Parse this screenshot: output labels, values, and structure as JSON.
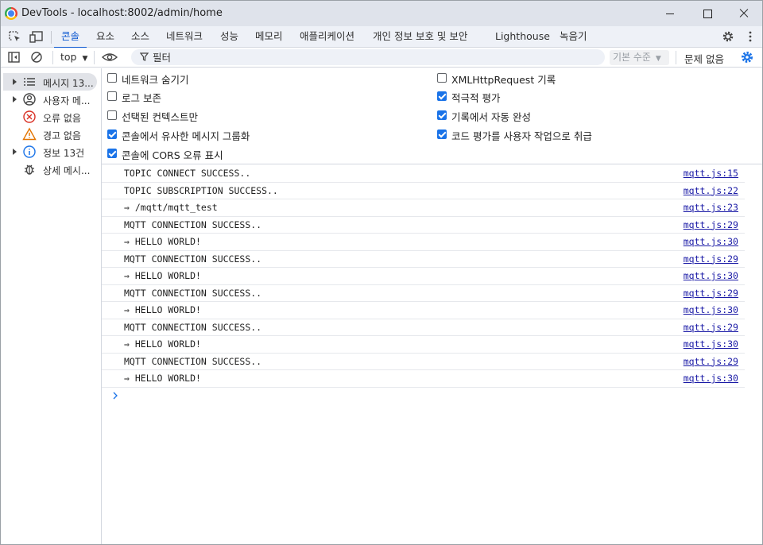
{
  "window": {
    "title": "DevTools - localhost:8002/admin/home"
  },
  "tabs": [
    {
      "label": "콘솔"
    },
    {
      "label": "요소"
    },
    {
      "label": "소스"
    },
    {
      "label": "네트워크"
    },
    {
      "label": "성능"
    },
    {
      "label": "메모리"
    },
    {
      "label": "애플리케이션"
    },
    {
      "label": "개인 정보 보호 및 보안"
    },
    {
      "label": "Lighthouse"
    },
    {
      "label": "녹음기"
    }
  ],
  "toolbar": {
    "context": "top",
    "filter_placeholder": "필터",
    "levels": "기본 수준",
    "issues": "문제 없음"
  },
  "sidebar": {
    "items": [
      {
        "label": "메시지 13...",
        "icon": "list-icon"
      },
      {
        "label": "사용자 메...",
        "icon": "user-circle-icon"
      },
      {
        "label": "오류 없음",
        "icon": "error-icon"
      },
      {
        "label": "경고 없음",
        "icon": "warning-icon"
      },
      {
        "label": "정보 13건",
        "icon": "info-icon"
      },
      {
        "label": "상세 메시...",
        "icon": "bug-icon"
      }
    ]
  },
  "settings": {
    "left": [
      {
        "label": "네트워크 숨기기",
        "checked": false
      },
      {
        "label": "로그 보존",
        "checked": false
      },
      {
        "label": "선택된 컨텍스트만",
        "checked": false
      },
      {
        "label": "콘솔에서 유사한 메시지 그룹화",
        "checked": true
      },
      {
        "label": "콘솔에 CORS 오류 표시",
        "checked": true
      }
    ],
    "right": [
      {
        "label": "XMLHttpRequest 기록",
        "checked": false
      },
      {
        "label": "적극적 평가",
        "checked": true
      },
      {
        "label": "기록에서 자동 완성",
        "checked": true
      },
      {
        "label": "코드 평가를 사용자 작업으로 취급",
        "checked": true
      }
    ]
  },
  "messages": [
    {
      "text": "TOPIC CONNECT SUCCESS..",
      "source": "mqtt.js:15"
    },
    {
      "text": "TOPIC SUBSCRIPTION SUCCESS..",
      "source": "mqtt.js:22"
    },
    {
      "text": "⇒ /mqtt/mqtt_test",
      "source": "mqtt.js:23"
    },
    {
      "text": "MQTT CONNECTION SUCCESS..",
      "source": "mqtt.js:29"
    },
    {
      "text": "⇒ HELLO WORLD!",
      "source": "mqtt.js:30"
    },
    {
      "text": "MQTT CONNECTION SUCCESS..",
      "source": "mqtt.js:29"
    },
    {
      "text": "⇒ HELLO WORLD!",
      "source": "mqtt.js:30"
    },
    {
      "text": "MQTT CONNECTION SUCCESS..",
      "source": "mqtt.js:29"
    },
    {
      "text": "⇒ HELLO WORLD!",
      "source": "mqtt.js:30"
    },
    {
      "text": "MQTT CONNECTION SUCCESS..",
      "source": "mqtt.js:29"
    },
    {
      "text": "⇒ HELLO WORLD!",
      "source": "mqtt.js:30"
    },
    {
      "text": "MQTT CONNECTION SUCCESS..",
      "source": "mqtt.js:29"
    },
    {
      "text": "⇒ HELLO WORLD!",
      "source": "mqtt.js:30"
    }
  ]
}
